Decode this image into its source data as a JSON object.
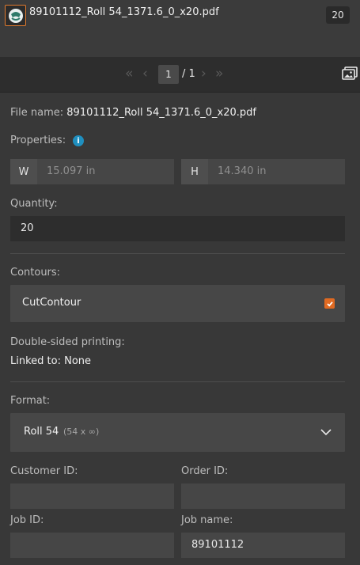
{
  "header": {
    "filename": "89101112_Roll 54_1371.6_0_x20.pdf",
    "quantity_badge": "20"
  },
  "pager": {
    "current_page": "1",
    "total_pages": "/ 1"
  },
  "details": {
    "file_name_label": "File name:",
    "file_name_value": "89101112_Roll 54_1371.6_0_x20.pdf",
    "properties_label": "Properties:",
    "width_tag": "W",
    "width_value": "15.097 in",
    "height_tag": "H",
    "height_value": "14.340 in",
    "quantity_label": "Quantity:",
    "quantity_value": "20",
    "contours_label": "Contours:",
    "contour_name": "CutContour",
    "contour_checked": true,
    "double_sided_label": "Double-sided printing:",
    "linked_to_label": "Linked to: None",
    "format_label": "Format:",
    "format_name": "Roll 54",
    "format_size": "(54 x ∞)",
    "customer_id_label": "Customer ID:",
    "customer_id_value": "",
    "order_id_label": "Order ID:",
    "order_id_value": "",
    "job_id_label": "Job ID:",
    "job_id_value": "",
    "job_name_label": "Job name:",
    "job_name_value": "89101112"
  },
  "colors": {
    "accent": "#e06a22",
    "info": "#1f8fbf",
    "background": "#383838"
  }
}
